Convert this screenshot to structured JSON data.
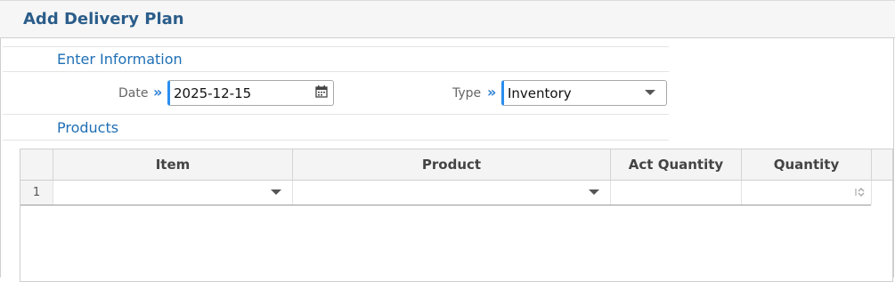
{
  "header": {
    "title": "Add Delivery Plan"
  },
  "sections": {
    "info_title": "Enter Information",
    "products_title": "Products"
  },
  "form": {
    "date_label": "Date",
    "date_value": "2025-12-15",
    "type_label": "Type",
    "type_value": "Inventory",
    "arrow_glyph": "»"
  },
  "grid": {
    "columns": [
      "Item",
      "Product",
      "Act Quantity",
      "Quantity"
    ],
    "rows": [
      {
        "num": "1",
        "item": "",
        "product": "",
        "act_quantity": "",
        "quantity": ""
      }
    ]
  },
  "icons": {
    "date": "calendar-icon",
    "type": "chevron-down-icon",
    "quantity": "spinner-icon"
  },
  "colors": {
    "accent": "#2a8ef0",
    "title": "#2b5d8a",
    "section": "#1f6fb5"
  }
}
